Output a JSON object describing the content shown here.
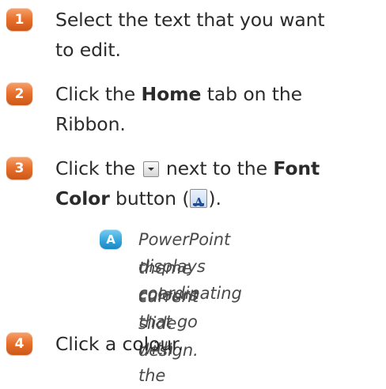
{
  "steps": [
    {
      "number": "1",
      "line1": "Select the text that you want",
      "line2": "to edit."
    },
    {
      "number": "2",
      "pre": "Click the ",
      "bold": "Home",
      "post": " tab on the",
      "line2": "Ribbon."
    },
    {
      "number": "3",
      "pre": "Click the ",
      "mid": " next to the ",
      "bold1": "Font",
      "bold2": "Color",
      "post2": " button (",
      "end2": ")."
    },
    {
      "number": "4",
      "line1": "Click a colour."
    }
  ],
  "callout": {
    "letter": "A",
    "lines": [
      "PowerPoint displays coordinating",
      "theme colours that go with the",
      "current slide design."
    ]
  },
  "icons": {
    "dropdown": "dropdown-arrow-icon",
    "font_color": "font-color-icon",
    "font_color_glyph": "A"
  },
  "colors": {
    "step_badge": "#e9712e",
    "callout_badge": "#36a6dd",
    "text": "#2b2b2b",
    "font_color_blue": "#1f4e96"
  }
}
